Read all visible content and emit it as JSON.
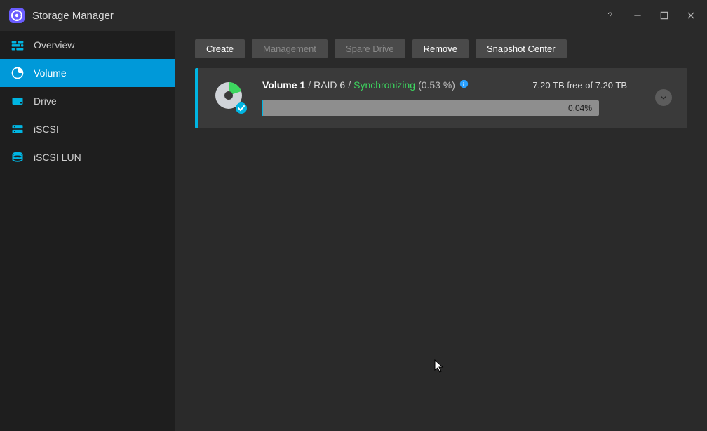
{
  "window": {
    "title": "Storage Manager"
  },
  "sidebar": {
    "items": [
      {
        "label": "Overview",
        "icon": "overview-icon"
      },
      {
        "label": "Volume",
        "icon": "volume-icon"
      },
      {
        "label": "Drive",
        "icon": "drive-icon"
      },
      {
        "label": "iSCSI",
        "icon": "iscsi-icon"
      },
      {
        "label": "iSCSI LUN",
        "icon": "iscsi-lun-icon"
      }
    ]
  },
  "toolbar": {
    "create": "Create",
    "manage": "Management",
    "spare": "Spare Drive",
    "remove": "Remove",
    "snapshot": "Snapshot Center"
  },
  "volumes": [
    {
      "name": "Volume 1",
      "raid": "RAID 6",
      "status": "Synchronizing",
      "status_pct": "(0.53 %)",
      "free": "7.20 TB free of 7.20 TB",
      "usage_label": "0.04%",
      "usage_width": "0.04%"
    }
  ],
  "separator": "/",
  "colors": {
    "accent": "#00b5e2",
    "status_green": "#3dd65f"
  }
}
